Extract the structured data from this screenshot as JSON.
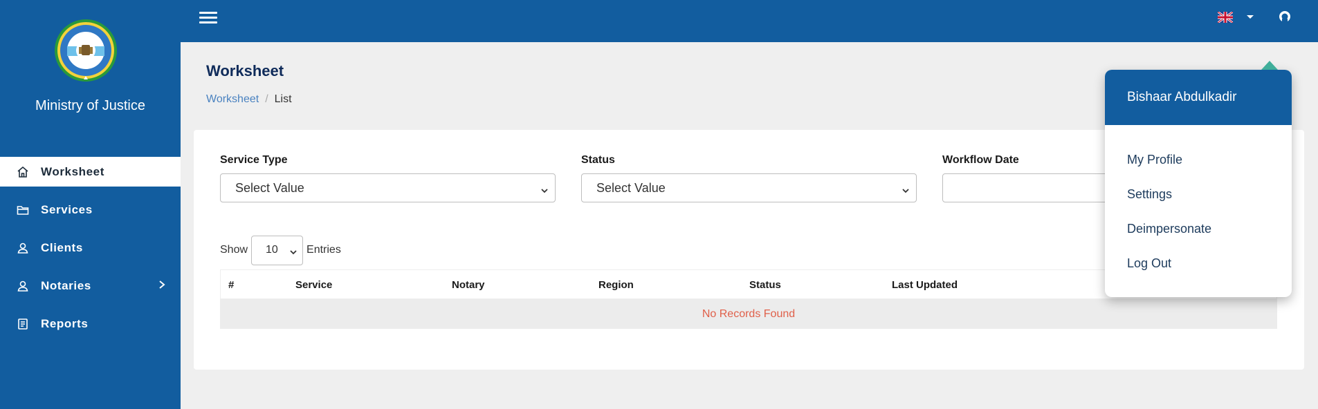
{
  "sidebar": {
    "org_name": "Ministry of Justice",
    "items": [
      {
        "label": "Worksheet",
        "icon": "home-icon",
        "active": true
      },
      {
        "label": "Services",
        "icon": "folder-icon"
      },
      {
        "label": "Clients",
        "icon": "user-icon"
      },
      {
        "label": "Notaries",
        "icon": "user-icon",
        "has_submenu": true
      },
      {
        "label": "Reports",
        "icon": "report-icon"
      }
    ]
  },
  "page": {
    "title": "Worksheet",
    "breadcrumb": {
      "link": "Worksheet",
      "separator": "/",
      "current": "List"
    }
  },
  "filters": {
    "service_type": {
      "label": "Service Type",
      "value": "Select Value"
    },
    "status": {
      "label": "Status",
      "value": "Select Value"
    },
    "workflow_date": {
      "label": "Workflow Date",
      "value": ""
    }
  },
  "table": {
    "show_label": "Show",
    "page_size": "10",
    "entries_label": "Entries",
    "columns": [
      "#",
      "Service",
      "Notary",
      "Region",
      "Status",
      "Last Updated"
    ],
    "empty_message": "No Records Found"
  },
  "user_menu": {
    "name": "Bishaar Abdulkadir",
    "items": [
      "My Profile",
      "Settings",
      "Deimpersonate",
      "Log Out"
    ]
  },
  "colors": {
    "primary": "#125d9f",
    "empty_message": "#e0604a",
    "breadcrumb_link": "#4a82c0"
  }
}
